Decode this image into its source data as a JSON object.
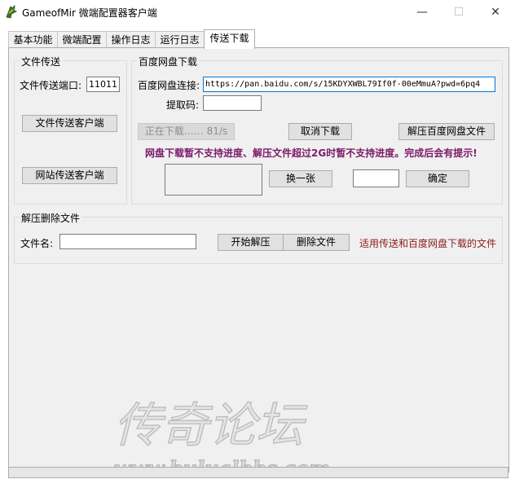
{
  "window": {
    "title": "GameofMir 微端配置器客户端",
    "controls": {
      "minimize": "—",
      "maximize": "☐",
      "close": "✕"
    }
  },
  "tabs": [
    "基本功能",
    "微端配置",
    "操作日志",
    "运行日志",
    "传送下载"
  ],
  "active_tab": "传送下载",
  "file_transfer": {
    "title": "文件传送",
    "port_label": "文件传送端口:",
    "port_value": "11011",
    "transfer_client_button": "文件传送客户端",
    "site_transfer_client_button": "网站传送客户端"
  },
  "baidu": {
    "title": "百度网盘下载",
    "link_label": "百度网盘连接:",
    "link_value": "https://pan.baidu.com/s/15KDYXWBL79If0f-00eMmuA?pwd=6pq4",
    "code_label": "提取码:",
    "code_value": "",
    "downloading_button": "正在下载…… 81/s",
    "cancel_button": "取消下载",
    "extract_button": "解压百度网盘文件",
    "notice": "网盘下载暂不支持进度、解压文件超过2G时暂不支持进度。完成后会有提示!",
    "refresh_captcha_button": "换一张",
    "captcha_value": "",
    "confirm_button": "确定"
  },
  "extract_delete": {
    "title": "解压删除文件",
    "filename_label": "文件名:",
    "filename_value": "",
    "start_extract_button": "开始解压",
    "delete_button": "删除文件",
    "hint": "适用传送和百度网盘下载的文件"
  },
  "watermark": {
    "text": "传奇论坛",
    "url": "www.bulualbbs.com"
  },
  "colors": {
    "notice": "#7b1b6b",
    "hint": "#8b1a1a",
    "focus_border": "#0078d7"
  }
}
